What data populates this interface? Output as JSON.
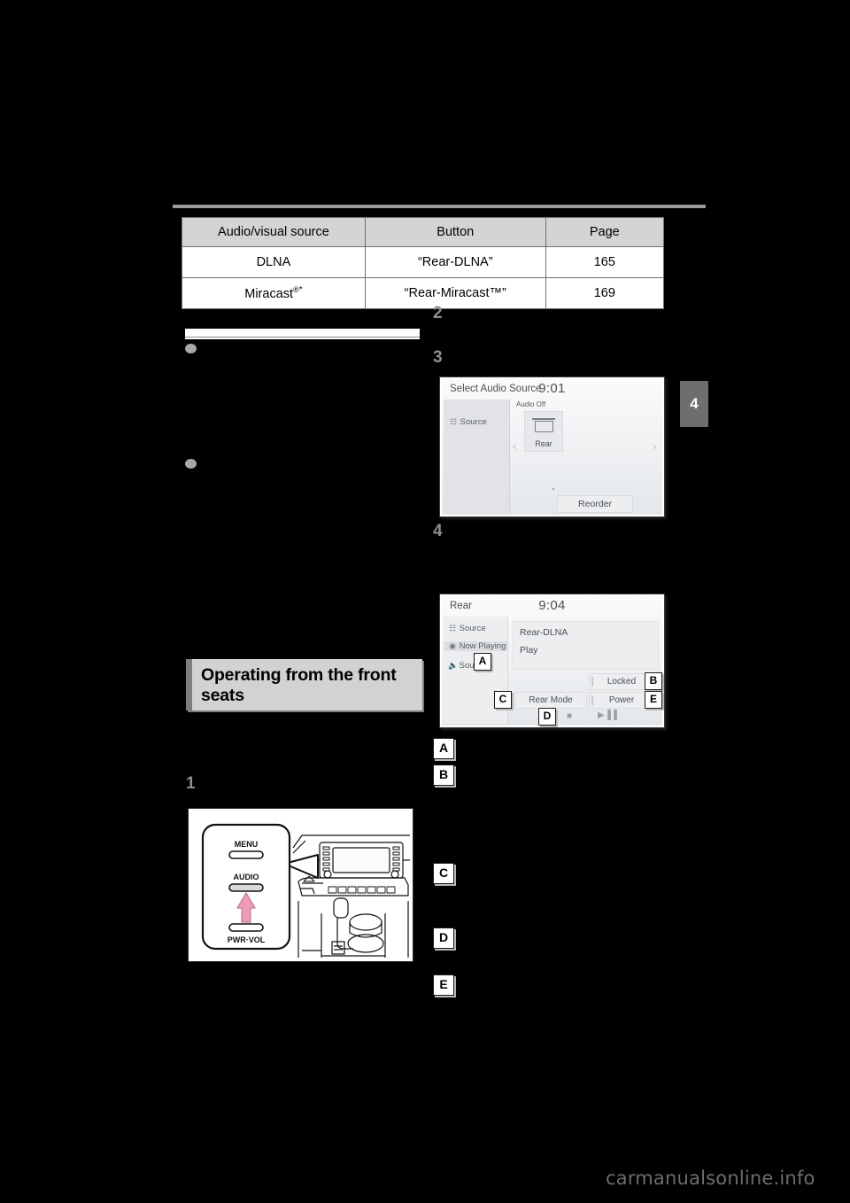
{
  "table": {
    "headers": [
      "Audio/visual source",
      "Button",
      "Page"
    ],
    "rows": [
      {
        "source": "DLNA",
        "source_sup": "",
        "source_ast": "",
        "button": "“Rear-DLNA”",
        "page": "165"
      },
      {
        "source": "Miracast",
        "source_sup": "®",
        "source_ast": "*",
        "button": "“Rear-Miracast™”",
        "page": "169"
      }
    ]
  },
  "chapter_tab": "4",
  "section_heading": "Operating from the front seats",
  "steps": {
    "left": [
      "1"
    ],
    "right": [
      "2",
      "3",
      "4"
    ]
  },
  "markers": [
    "A",
    "B",
    "C",
    "D",
    "E"
  ],
  "screenshot_select_audio_source": {
    "title": "Select Audio Source",
    "clock": "9:01",
    "rail_items": [
      {
        "label": "Source",
        "icon": "source-icon"
      }
    ],
    "audio_off_label": "Audio Off",
    "tile_label": "Rear",
    "reorder_label": "Reorder",
    "prev_arrow": "‹",
    "next_arrow": "›"
  },
  "screenshot_rear": {
    "title": "Rear",
    "clock": "9:04",
    "rail_items": [
      {
        "label": "Source",
        "icon": "source-icon",
        "selected": false
      },
      {
        "label": "Now Playing",
        "icon": "play-circle-icon",
        "selected": true
      },
      {
        "label": "Sound",
        "icon": "speaker-icon",
        "selected": false
      }
    ],
    "panel_lines": [
      "Rear-DLNA",
      "Play"
    ],
    "buttons": {
      "locked": "Locked",
      "rear_mode": "Rear Mode",
      "power": "Power"
    },
    "transport": {
      "stop": "■",
      "play_pause": "▶▐▐"
    },
    "marker_a": "A",
    "marker_b": "B",
    "marker_c": "C",
    "marker_d": "D",
    "marker_e": "E"
  },
  "illustration": {
    "name": "front-dashboard-audio-button",
    "callout_labels": {
      "menu": "MENU",
      "audio": "AUDIO",
      "pwr_vol": "PWR·VOL"
    },
    "highlight_color": "#f09ab9"
  },
  "watermark": "carmanualsonline.info"
}
